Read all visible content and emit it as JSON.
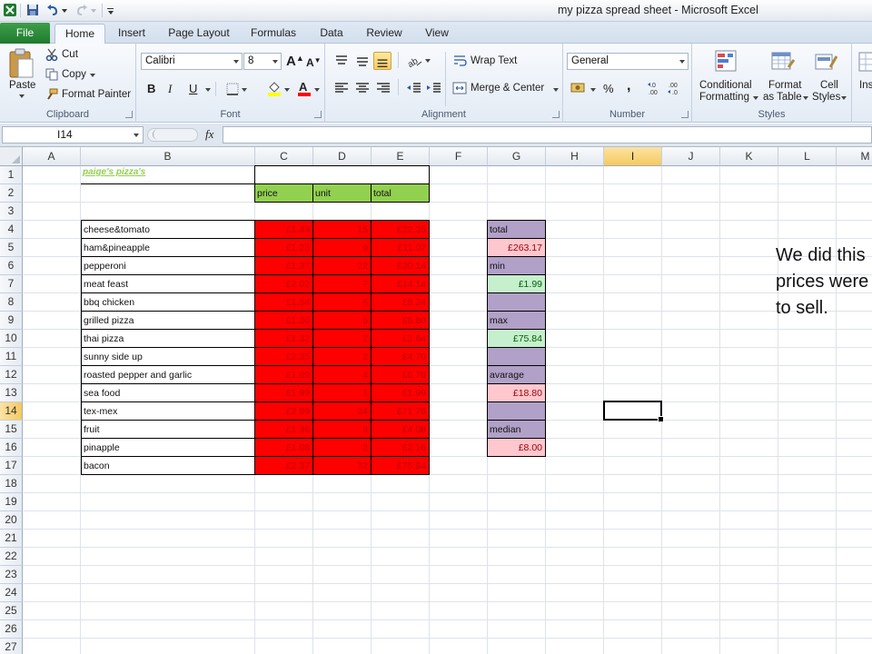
{
  "window": {
    "title": "my pizza spread sheet  -  Microsoft Excel"
  },
  "tabs": {
    "file": "File",
    "items": [
      "Home",
      "Insert",
      "Page Layout",
      "Formulas",
      "Data",
      "Review",
      "View"
    ],
    "active": "Home"
  },
  "ribbon": {
    "clipboard": {
      "label": "Clipboard",
      "paste": "Paste",
      "cut": "Cut",
      "copy": "Copy",
      "format_painter": "Format Painter"
    },
    "font": {
      "label": "Font",
      "name": "Calibri",
      "size": "8",
      "bold": "B",
      "italic": "I",
      "underline": "U"
    },
    "alignment": {
      "label": "Alignment",
      "wrap_text": "Wrap Text",
      "merge_center": "Merge & Center"
    },
    "number": {
      "label": "Number",
      "format": "General",
      "percent": "%",
      "comma": ","
    },
    "styles": {
      "label": "Styles",
      "conditional_1": "Conditional",
      "conditional_2": "Formatting",
      "format_table_1": "Format",
      "format_table_2": "as Table",
      "cell_styles_1": "Cell",
      "cell_styles_2": "Styles"
    },
    "cells": {
      "insert_partial": "Ins"
    }
  },
  "formula_bar": {
    "name_box": "I14",
    "fx": "fx",
    "formula": ""
  },
  "sheet": {
    "columns": [
      "A",
      "B",
      "C",
      "D",
      "E",
      "F",
      "G",
      "H",
      "I",
      "J",
      "K",
      "L",
      "M"
    ],
    "selected_column": "I",
    "rows": [
      "1",
      "2",
      "3",
      "4",
      "5",
      "6",
      "7",
      "8",
      "9",
      "10",
      "11",
      "12",
      "13",
      "14",
      "15",
      "16",
      "17",
      "18",
      "19",
      "20",
      "21",
      "22",
      "23",
      "24",
      "25",
      "26",
      "27"
    ],
    "selected_row": "14",
    "title": "paige's pizza's",
    "headers": {
      "price": "price",
      "unit": "unit",
      "total": "total"
    },
    "items": [
      {
        "name": "cheese&tomato",
        "price": "£1.49",
        "unit": "15",
        "total": "£22.35"
      },
      {
        "name": "ham&pineapple",
        "price": "£1.23",
        "unit": "9",
        "total": "£11.07"
      },
      {
        "name": "pepperoni",
        "price": "£1.37",
        "unit": "22",
        "total": "£30.14"
      },
      {
        "name": "meat feast",
        "price": "£2.02",
        "unit": "7",
        "total": "£14.14"
      },
      {
        "name": "bbq chicken",
        "price": "£1.54",
        "unit": "6",
        "total": "£9.24"
      },
      {
        "name": "grilled pizza",
        "price": "£1.36",
        "unit": "5",
        "total": "£6.80"
      },
      {
        "name": "thai pizza",
        "price": "£1.32",
        "unit": "2",
        "total": "£2.64"
      },
      {
        "name": "sunny side up",
        "price": "£2.35",
        "unit": "2",
        "total": "£4.70"
      },
      {
        "name": "roasted pepper and garlic",
        "price": "£1.69",
        "unit": "4",
        "total": "£6.76"
      },
      {
        "name": "sea food",
        "price": "£1.99",
        "unit": "1",
        "total": "£1.99"
      },
      {
        "name": "tex-mex",
        "price": "£2.99",
        "unit": "24",
        "total": "£71.76"
      },
      {
        "name": "fruit",
        "price": "£1.36",
        "unit": "3",
        "total": "£4.08"
      },
      {
        "name": "pinapple",
        "price": "£1.08",
        "unit": "2",
        "total": "£2.16"
      },
      {
        "name": "bacon",
        "price": "£2.37",
        "unit": "32",
        "total": "£75.84"
      }
    ],
    "stats": {
      "total_label": "total",
      "total_value": "£263.17",
      "min_label": "min",
      "min_value": "£1.99",
      "max_label": "max",
      "max_value": "£75.84",
      "average_label": "avarage",
      "average_value": "£18.80",
      "median_label": "median",
      "median_value": "£8.00"
    },
    "note_lines": [
      "We did this",
      "prices were",
      "to sell."
    ]
  }
}
